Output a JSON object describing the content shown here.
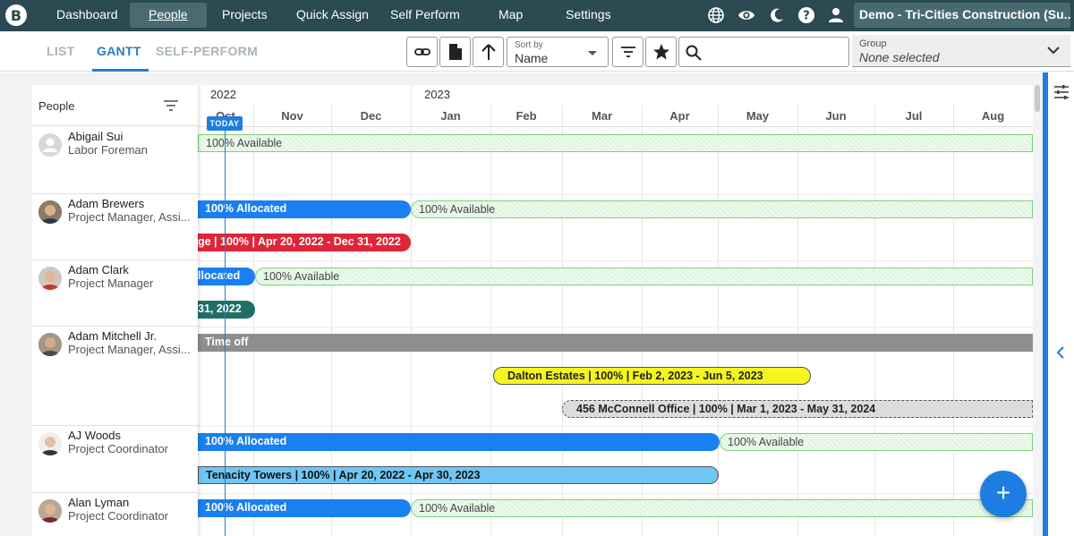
{
  "nav": {
    "logo": "B",
    "items": [
      {
        "label": "Dashboard"
      },
      {
        "label": "People"
      },
      {
        "label": "Projects"
      },
      {
        "label": "Quick Assign"
      },
      {
        "label": "Self Perform"
      },
      {
        "label": "Map"
      },
      {
        "label": "Settings"
      }
    ],
    "account_label": "Demo - Tri-Cities Construction (Su..."
  },
  "view_tabs": [
    {
      "label": "LIST"
    },
    {
      "label": "GANTT"
    },
    {
      "label": "SELF-PERFORM"
    }
  ],
  "toolbar": {
    "sort_label": "Sort by",
    "sort_value": "Name",
    "search_placeholder": "",
    "group_label": "Group",
    "group_value": "None selected"
  },
  "people_header": "People",
  "people": [
    {
      "name": "Abigail Sui",
      "role": "Labor Foreman"
    },
    {
      "name": "Adam Brewers",
      "role": "Project Manager, Assi..."
    },
    {
      "name": "Adam Clark",
      "role": "Project Manager"
    },
    {
      "name": "Adam Mitchell Jr.",
      "role": "Project Manager, Assi..."
    },
    {
      "name": "AJ Woods",
      "role": "Project Coordinator"
    },
    {
      "name": "Alan Lyman",
      "role": "Project Coordinator"
    }
  ],
  "timeline": {
    "years": [
      "2022",
      "2023"
    ],
    "months": [
      "Oct",
      "Nov",
      "Dec",
      "Jan",
      "Feb",
      "Mar",
      "Apr",
      "May",
      "Jun",
      "Jul",
      "Aug"
    ],
    "today_label": "TODAY"
  },
  "bars": {
    "b1": "100% Available",
    "b2": "100% Allocated",
    "b3": "100% Available",
    "b4": "ge | 100% | Apr 20, 2022 - Dec 31, 2022",
    "b5": "llocated",
    "b6": "100% Available",
    "b7": "31, 2022",
    "b8": "Time off",
    "b9": "Dalton Estates | 100% | Feb 2, 2023 - Jun 5, 2023",
    "b10": "456 McConnell Office | 100% | Mar 1, 2023 - May 31, 2024",
    "b11": "100% Allocated",
    "b12": "100% Available",
    "b13": "Tenacity Towers | 100% | Apr 20, 2022 - Apr 30, 2023",
    "b14": "100% Allocated",
    "b15": "100% Available"
  },
  "fab_label": "+",
  "colors": {
    "nav_bg": "#2b4a52",
    "accent": "#1e7de0",
    "allocated": "#1a7ff0",
    "available": "#dff5df",
    "red_project": "#e0243a",
    "teal_project": "#1f6f66",
    "time_off": "#8e8e8e",
    "yellow_project": "#f5f51f",
    "light_blue_project": "#6fc6f5"
  }
}
